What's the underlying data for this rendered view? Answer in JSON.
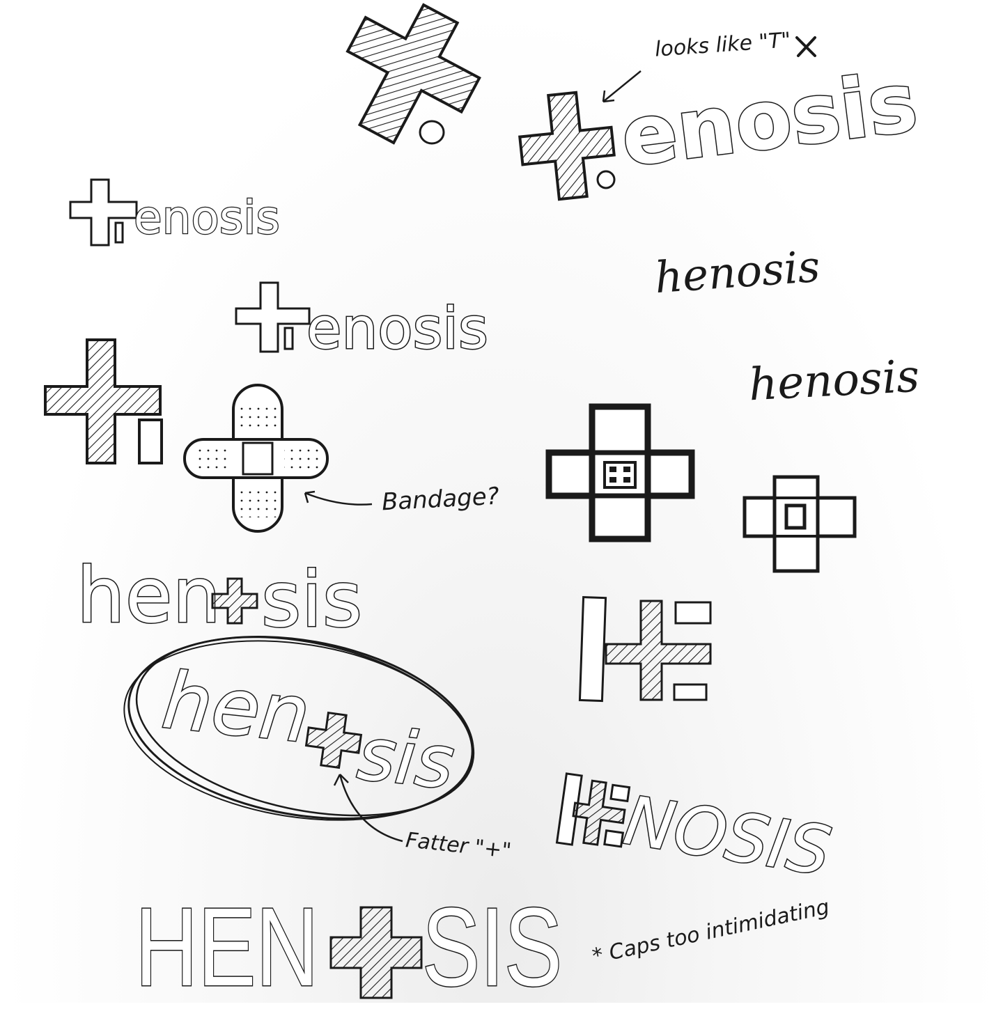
{
  "palette": {
    "ink": "#1a1a1a",
    "paper": "#ffffff",
    "hatch": "#1a1a1a"
  },
  "notes": {
    "looks_like": "looks like \"T\"",
    "bandage": "Bandage?",
    "fatter": "Fatter \"+\"",
    "caps": "* Caps too intimidating"
  },
  "words": {
    "enosis_large": "enosis",
    "enosis_small": "enosis",
    "enosis_mid": "enosis",
    "henosis_script_1": "henosis",
    "henosis_script_2": "henosis",
    "hen_1": "hen",
    "sis_1": "sis",
    "hen_2": "hen",
    "sis_2": "sis",
    "nosis_caps": "NOSIS",
    "hen_caps": "HEN",
    "sis_caps": "SIS"
  },
  "icons": {
    "big_cross": "hatched-cross-icon",
    "bandage": "bandage-cross-icon",
    "h_plus": "h-plus-monogram-icon",
    "box_cross": "box-cross-icon"
  }
}
